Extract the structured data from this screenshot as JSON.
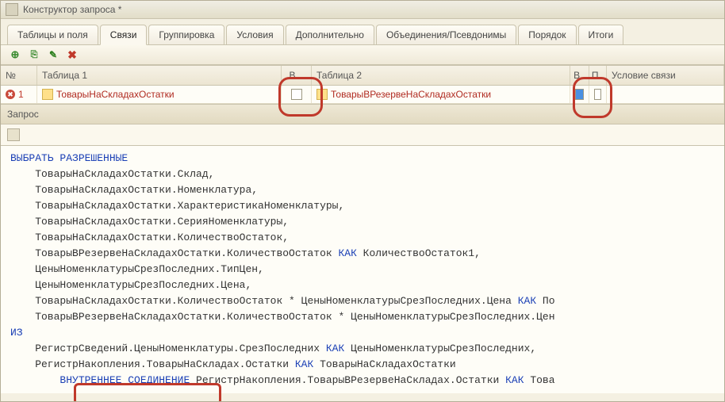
{
  "window": {
    "title": "Конструктор запроса *"
  },
  "tabs": [
    {
      "label": "Таблицы и поля",
      "active": false
    },
    {
      "label": "Связи",
      "active": true
    },
    {
      "label": "Группировка",
      "active": false
    },
    {
      "label": "Условия",
      "active": false
    },
    {
      "label": "Дополнительно",
      "active": false
    },
    {
      "label": "Объединения/Псевдонимы",
      "active": false
    },
    {
      "label": "Порядок",
      "active": false
    },
    {
      "label": "Итоги",
      "active": false
    }
  ],
  "toolbar": {
    "add": "add-icon",
    "copy": "copy-icon",
    "edit": "edit-icon",
    "delete": "delete-icon"
  },
  "grid": {
    "headers": {
      "num": "№",
      "t1": "Таблица 1",
      "v1": "В...",
      "t2": "Таблица 2",
      "v2": "В..",
      "p": "П..",
      "cond": "Условие связи"
    },
    "rows": [
      {
        "num": "1",
        "t1": "ТоварыНаСкладахОстатки",
        "v1": false,
        "t2": "ТоварыВРезервеНаСкладахОстатки",
        "v2_selected": true,
        "v2": false,
        "p": false,
        "cond": ""
      }
    ]
  },
  "section": {
    "label": "Запрос"
  },
  "code": {
    "lines": [
      {
        "t": "ВЫБРАТЬ РАЗРЕШЕННЫЕ",
        "kw": true,
        "indent": 0
      },
      {
        "t": "ТоварыНаСкладахОстатки.Склад,",
        "indent": 1
      },
      {
        "t": "ТоварыНаСкладахОстатки.Номенклатура,",
        "indent": 1
      },
      {
        "t": "ТоварыНаСкладахОстатки.ХарактеристикаНоменклатуры,",
        "indent": 1
      },
      {
        "t": "ТоварыНаСкладахОстатки.СерияНоменклатуры,",
        "indent": 1
      },
      {
        "t": "ТоварыНаСкладахОстатки.КоличествоОстаток,",
        "indent": 1
      },
      {
        "segments": [
          {
            "t": "ТоварыВРезервеНаСкладахОстатки.КоличествоОстаток "
          },
          {
            "t": "КАК",
            "kw": true
          },
          {
            "t": " КоличествоОстаток1,"
          }
        ],
        "indent": 1
      },
      {
        "t": "ЦеныНоменклатурыСрезПоследних.ТипЦен,",
        "indent": 1
      },
      {
        "t": "ЦеныНоменклатурыСрезПоследних.Цена,",
        "indent": 1
      },
      {
        "segments": [
          {
            "t": "ТоварыНаСкладахОстатки.КоличествоОстаток * ЦеныНоменклатурыСрезПоследних.Цена "
          },
          {
            "t": "КАК",
            "kw": true
          },
          {
            "t": " По"
          }
        ],
        "indent": 1
      },
      {
        "segments": [
          {
            "t": "ТоварыВРезервеНаСкладахОстатки.КоличествоОстаток * ЦеныНоменклатурыСрезПоследних.Цен"
          }
        ],
        "indent": 1
      },
      {
        "t": "ИЗ",
        "kw": true,
        "indent": 0
      },
      {
        "segments": [
          {
            "t": "РегистрСведений.ЦеныНоменклатуры.СрезПоследних "
          },
          {
            "t": "КАК",
            "kw": true
          },
          {
            "t": " ЦеныНоменклатурыСрезПоследних,"
          }
        ],
        "indent": 1
      },
      {
        "segments": [
          {
            "t": "РегистрНакопления.ТоварыНаСкладах.Остатки "
          },
          {
            "t": "КАК",
            "kw": true
          },
          {
            "t": " ТоварыНаСкладахОстатки"
          }
        ],
        "indent": 1
      },
      {
        "segments": [
          {
            "t": "ВНУТРЕННЕЕ СОЕДИНЕНИЕ",
            "kw": true
          },
          {
            "t": " РегистрНакопления.ТоварыВРезервеНаСкладах.Остатки "
          },
          {
            "t": "КАК",
            "kw": true
          },
          {
            "t": " Това"
          }
        ],
        "indent": 2
      }
    ]
  }
}
